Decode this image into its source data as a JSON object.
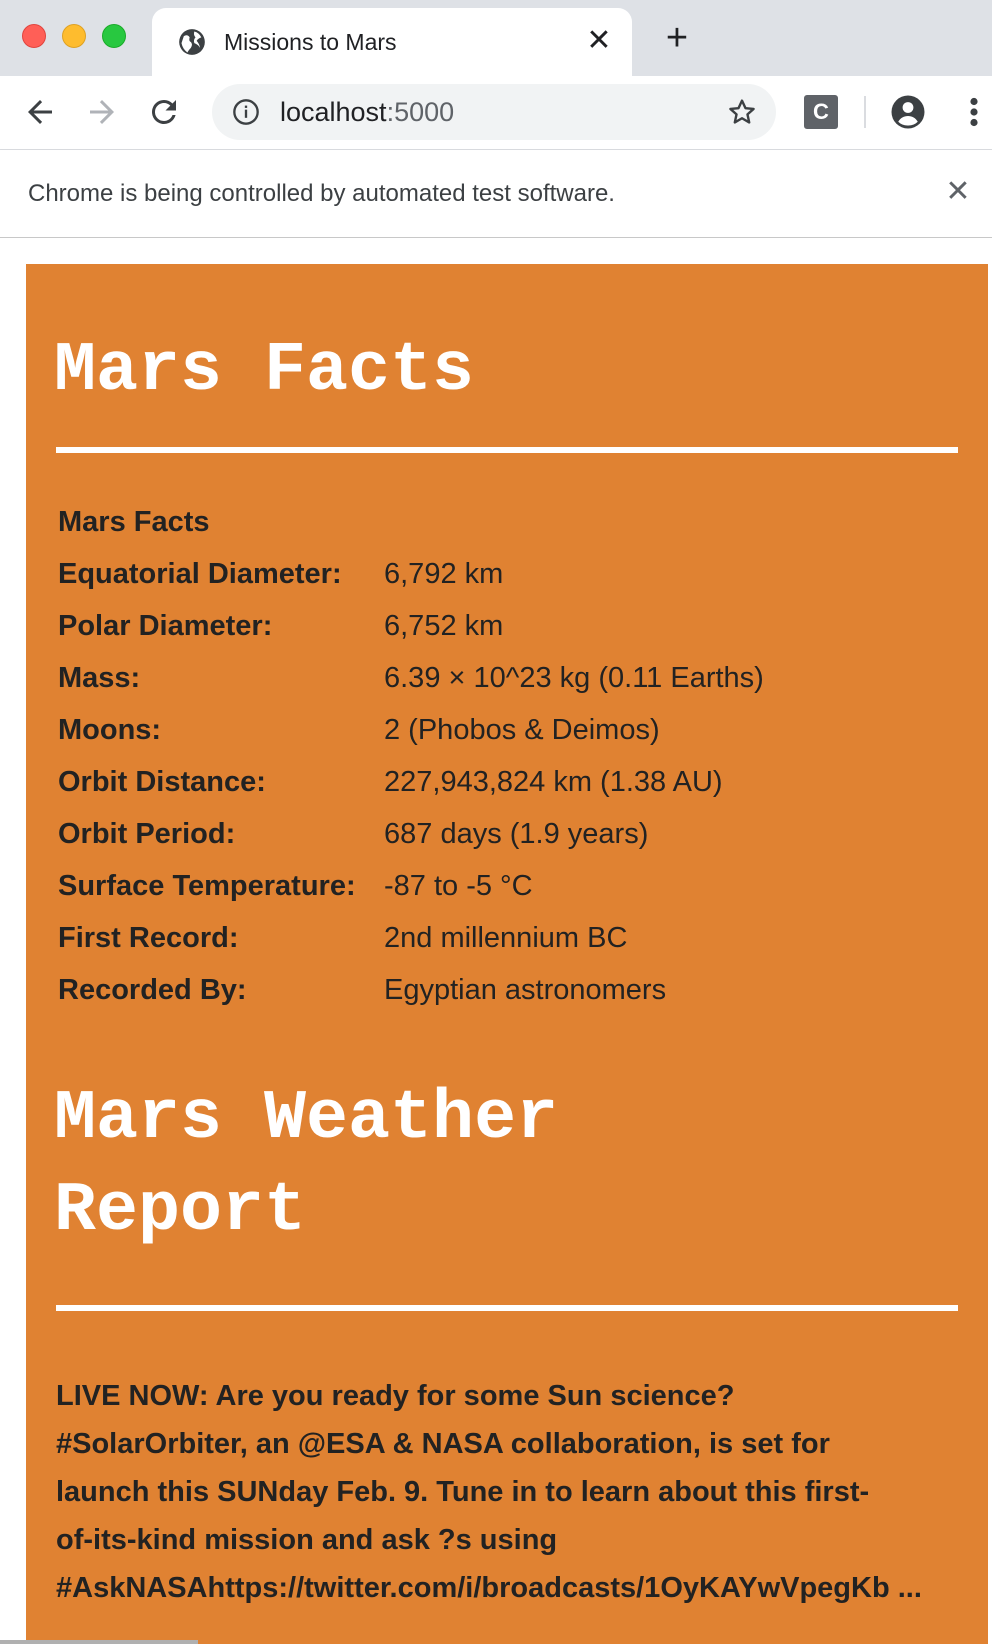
{
  "browser": {
    "tab_title": "Missions to Mars",
    "url_host": "localhost",
    "url_port": ":5000",
    "infobar_text": "Chrome is being controlled by automated test software.",
    "extension_label": "C"
  },
  "page": {
    "facts_heading": "Mars Facts",
    "weather_heading_line1": "Mars Weather",
    "weather_heading_line2": "Report",
    "facts_table": {
      "header": "Mars Facts",
      "rows": [
        {
          "label": "Equatorial Diameter:",
          "value": "6,792 km"
        },
        {
          "label": "Polar Diameter:",
          "value": "6,752 km"
        },
        {
          "label": "Mass:",
          "value": "6.39 × 10^23 kg (0.11 Earths)"
        },
        {
          "label": "Moons:",
          "value": "2 (Phobos & Deimos)"
        },
        {
          "label": "Orbit Distance:",
          "value": "227,943,824 km (1.38 AU)"
        },
        {
          "label": "Orbit Period:",
          "value": "687 days (1.9 years)"
        },
        {
          "label": "Surface Temperature:",
          "value": "-87 to -5 °C"
        },
        {
          "label": "First Record:",
          "value": "2nd millennium BC"
        },
        {
          "label": "Recorded By:",
          "value": "Egyptian astronomers"
        }
      ]
    },
    "weather_lines": [
      "LIVE NOW: Are you ready for some Sun science?",
      "#SolarOrbiter, an @ESA & NASA collaboration, is set for",
      "launch this SUNday Feb. 9. Tune in to learn about this first-",
      "of-its-kind mission and ask ?s using",
      "#AskNASAhttps://twitter.com/i/broadcasts/1OyKAYwVpegKb ..."
    ]
  },
  "colors": {
    "panel": "#e08232",
    "heading": "#ffffff",
    "text": "#222222"
  }
}
